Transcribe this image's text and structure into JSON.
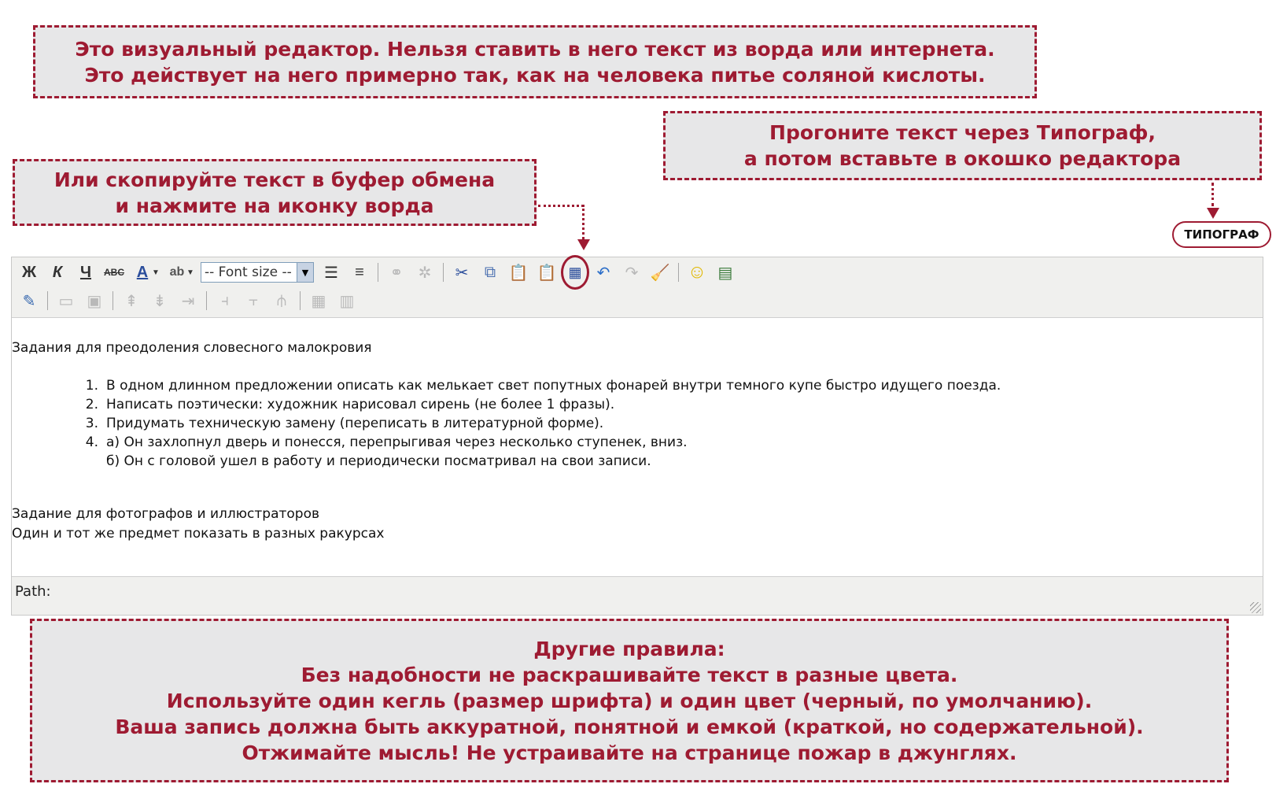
{
  "callouts": {
    "top": [
      "Это визуальный редактор. Нельзя ставить в него текст из ворда или интернета.",
      "Это действует на него примерно так, как на человека питье соляной кислоты."
    ],
    "typograf": [
      "Прогоните текст через Типограф,",
      "а потом вставьте в окошко редактора"
    ],
    "word": [
      "Или скопируйте текст в буфер обмена",
      "и нажмите на иконку ворда"
    ],
    "rules": [
      "Другие правила:",
      "Без надобности не раскрашивайте текст в разные цвета.",
      "Используйте один кегль (размер шрифта) и один цвет (черный, по умолчанию).",
      "Ваша запись должна быть аккуратной, понятной и емкой (краткой, но содержательной).",
      "Отжимайте мысль! Не устраивайте на странице пожар в джунглях."
    ]
  },
  "typograf_button": "ТИПОГРАФ",
  "toolbar": {
    "bold": "Ж",
    "italic": "К",
    "underline": "Ч",
    "strike": "ABC",
    "font_color": "A",
    "highlight": "ab",
    "font_size": "-- Font size --"
  },
  "content": {
    "heading1": "Задания для преодоления словесного малокровия",
    "tasks": [
      {
        "num": "1.",
        "text": "В одном длинном предложении описать как мелькает свет попутных фонарей внутри темного купе быстро идущего поезда."
      },
      {
        "num": "2.",
        "text": "Написать поэтически: художник нарисовал сирень (не более 1 фразы)."
      },
      {
        "num": "3.",
        "text": "Придумать техническую замену (переписать в литературной форме)."
      },
      {
        "num": "4.",
        "text": "а) Он захлопнул дверь и понесся, перепрыгивая через несколько ступенек, вниз."
      },
      {
        "num": "",
        "text": "б) Он с головой ушел в работу и периодически посматривал на свои записи."
      }
    ],
    "heading2": "Задание для фотографов и иллюстраторов",
    "paragraph2": "Один и тот же предмет показать в разных ракурсах"
  },
  "path_label": "Path:",
  "colors": {
    "accent": "#9e1b32",
    "callout_bg": "#e7e7e8"
  }
}
